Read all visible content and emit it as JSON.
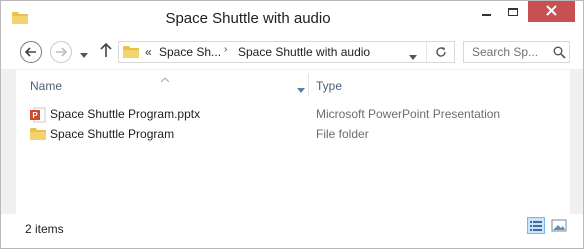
{
  "window": {
    "title": "Space Shuttle with audio"
  },
  "nav": {
    "back_icon": "back-arrow-icon",
    "forward_icon": "forward-arrow-icon",
    "up_icon": "up-arrow-icon",
    "address": {
      "overflow": "«",
      "segments": [
        "Space Sh...",
        "Space Shuttle with audio"
      ],
      "separator": "›"
    },
    "search": {
      "placeholder": "Search Sp..."
    }
  },
  "columns": {
    "name": "Name",
    "type": "Type"
  },
  "files": [
    {
      "name": "Space Shuttle Program.pptx",
      "type": "Microsoft PowerPoint Presentation",
      "icon": "powerpoint-file-icon"
    },
    {
      "name": "Space Shuttle Program",
      "type": "File folder",
      "icon": "folder-icon"
    }
  ],
  "status": {
    "item_count": "2 items"
  },
  "colors": {
    "close_button": "#c75050",
    "header_text": "#4c607a",
    "folder": "#e8c04a",
    "powerpoint": "#d04a2a",
    "view_active": "#cce4f7"
  }
}
